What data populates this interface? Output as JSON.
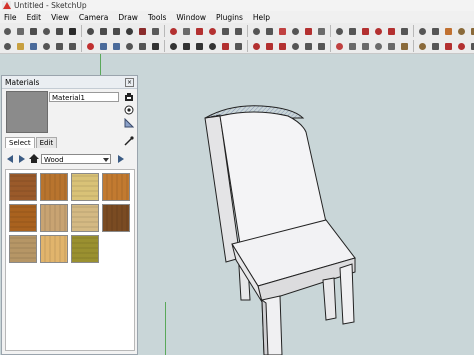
{
  "window": {
    "title": "Untitled - SketchUp"
  },
  "menubar": [
    "File",
    "Edit",
    "View",
    "Camera",
    "Draw",
    "Tools",
    "Window",
    "Plugins",
    "Help"
  ],
  "toolbar": {
    "row1": [
      {
        "name": "select-icon",
        "color": "#5a5a5a"
      },
      {
        "name": "make-component-icon",
        "color": "#6a6a6a"
      },
      {
        "name": "eraser-icon",
        "color": "#4d4d4d"
      },
      {
        "name": "paint-bucket-icon",
        "color": "#555"
      },
      {
        "name": "rectangle-icon",
        "color": "#4a4a4a"
      },
      {
        "name": "line-icon",
        "color": "#2a2a2a"
      },
      {
        "name": "circle-icon",
        "color": "#4a4a4a"
      },
      {
        "name": "arc-icon",
        "color": "#4a4a4a"
      },
      {
        "name": "polygon-icon",
        "color": "#4a4a4a"
      },
      {
        "name": "freehand-icon",
        "color": "#3a3a3a"
      },
      {
        "name": "move-icon",
        "color": "#8a2b2b"
      },
      {
        "name": "push-pull-icon",
        "color": "#5a5a5a"
      },
      {
        "name": "rotate-icon",
        "color": "#b33030"
      },
      {
        "name": "follow-me-icon",
        "color": "#6a6a6a"
      },
      {
        "name": "scale-icon",
        "color": "#b33030"
      },
      {
        "name": "offset-icon",
        "color": "#b33030"
      },
      {
        "name": "tape-measure-icon",
        "color": "#555"
      },
      {
        "name": "dimension-icon",
        "color": "#555"
      },
      {
        "name": "protractor-icon",
        "color": "#555"
      },
      {
        "name": "text-icon",
        "color": "#555"
      },
      {
        "name": "axes-icon",
        "color": "#c04040"
      },
      {
        "name": "3d-text-icon",
        "color": "#555"
      },
      {
        "name": "orbit-icon",
        "color": "#b33030"
      },
      {
        "name": "pan-icon",
        "color": "#6a6a6a"
      },
      {
        "name": "zoom-icon",
        "color": "#555"
      },
      {
        "name": "zoom-window-icon",
        "color": "#555"
      },
      {
        "name": "zoom-extents-icon",
        "color": "#b33030"
      },
      {
        "name": "previous-view-icon",
        "color": "#b33030"
      },
      {
        "name": "next-view-icon",
        "color": "#b33030"
      },
      {
        "name": "position-camera-icon",
        "color": "#555"
      },
      {
        "name": "walk-icon",
        "color": "#555"
      },
      {
        "name": "look-around-icon",
        "color": "#555"
      },
      {
        "name": "section-plane-icon",
        "color": "#c07030"
      },
      {
        "name": "iso-view-icon",
        "color": "#8a6a3a"
      },
      {
        "name": "top-view-icon",
        "color": "#8a6a3a"
      }
    ],
    "row2": [
      {
        "name": "new-icon",
        "color": "#555"
      },
      {
        "name": "open-icon",
        "color": "#c8a040"
      },
      {
        "name": "save-icon",
        "color": "#4a6a9a"
      },
      {
        "name": "cut-icon",
        "color": "#555"
      },
      {
        "name": "copy-icon",
        "color": "#555"
      },
      {
        "name": "paste-icon",
        "color": "#555"
      },
      {
        "name": "erase-icon",
        "color": "#c03030"
      },
      {
        "name": "undo-icon",
        "color": "#4a6a9a"
      },
      {
        "name": "redo-icon",
        "color": "#4a6a9a"
      },
      {
        "name": "print-icon",
        "color": "#555"
      },
      {
        "name": "model-info-icon",
        "color": "#555"
      },
      {
        "name": "select-tool-icon",
        "color": "#333"
      },
      {
        "name": "rectangle-tool-icon",
        "color": "#333"
      },
      {
        "name": "line-tool-icon",
        "color": "#333"
      },
      {
        "name": "circle-tool-icon",
        "color": "#333"
      },
      {
        "name": "arc-tool-icon",
        "color": "#333"
      },
      {
        "name": "move-tool-icon",
        "color": "#b33030"
      },
      {
        "name": "pushpull-tool-icon",
        "color": "#555"
      },
      {
        "name": "rotate-tool-icon",
        "color": "#b33030"
      },
      {
        "name": "follow-tool-icon",
        "color": "#b33030"
      },
      {
        "name": "scale-tool-icon",
        "color": "#b33030"
      },
      {
        "name": "offset-tool-icon",
        "color": "#555"
      },
      {
        "name": "tape-tool-icon",
        "color": "#555"
      },
      {
        "name": "text-tool-icon",
        "color": "#555"
      },
      {
        "name": "axes-tool-icon",
        "color": "#c04040"
      },
      {
        "name": "xray-icon",
        "color": "#6a6a6a"
      },
      {
        "name": "back-edges-icon",
        "color": "#6a6a6a"
      },
      {
        "name": "wireframe-icon",
        "color": "#6a6a6a"
      },
      {
        "name": "hidden-line-icon",
        "color": "#6a6a6a"
      },
      {
        "name": "shaded-icon",
        "color": "#8a6a3a"
      },
      {
        "name": "textured-icon",
        "color": "#8a6a3a"
      },
      {
        "name": "monochrome-icon",
        "color": "#555"
      },
      {
        "name": "get-models-icon",
        "color": "#b33030"
      },
      {
        "name": "share-model-icon",
        "color": "#b33030"
      },
      {
        "name": "photo-textures-icon",
        "color": "#555"
      }
    ]
  },
  "materials_panel": {
    "title": "Materials",
    "name_value": "Material1",
    "tabs": [
      "Select",
      "Edit"
    ],
    "library": "Wood",
    "swatch_color": "#8b8b8b",
    "textures": [
      {
        "name": "wood-texture-1",
        "color": "#9a5a2a"
      },
      {
        "name": "wood-texture-2",
        "color": "#b8742e"
      },
      {
        "name": "wood-texture-3",
        "color": "#d9c277"
      },
      {
        "name": "wood-texture-4",
        "color": "#c27a30"
      },
      {
        "name": "wood-texture-5",
        "color": "#a9621f"
      },
      {
        "name": "wood-texture-6",
        "color": "#c8a372"
      },
      {
        "name": "wood-texture-7",
        "color": "#d4b983"
      },
      {
        "name": "wood-texture-8",
        "color": "#7a4b22"
      },
      {
        "name": "wood-texture-9",
        "color": "#b69666"
      },
      {
        "name": "wood-texture-10",
        "color": "#e1b46c"
      },
      {
        "name": "wood-texture-11",
        "color": "#9a9030"
      }
    ]
  }
}
